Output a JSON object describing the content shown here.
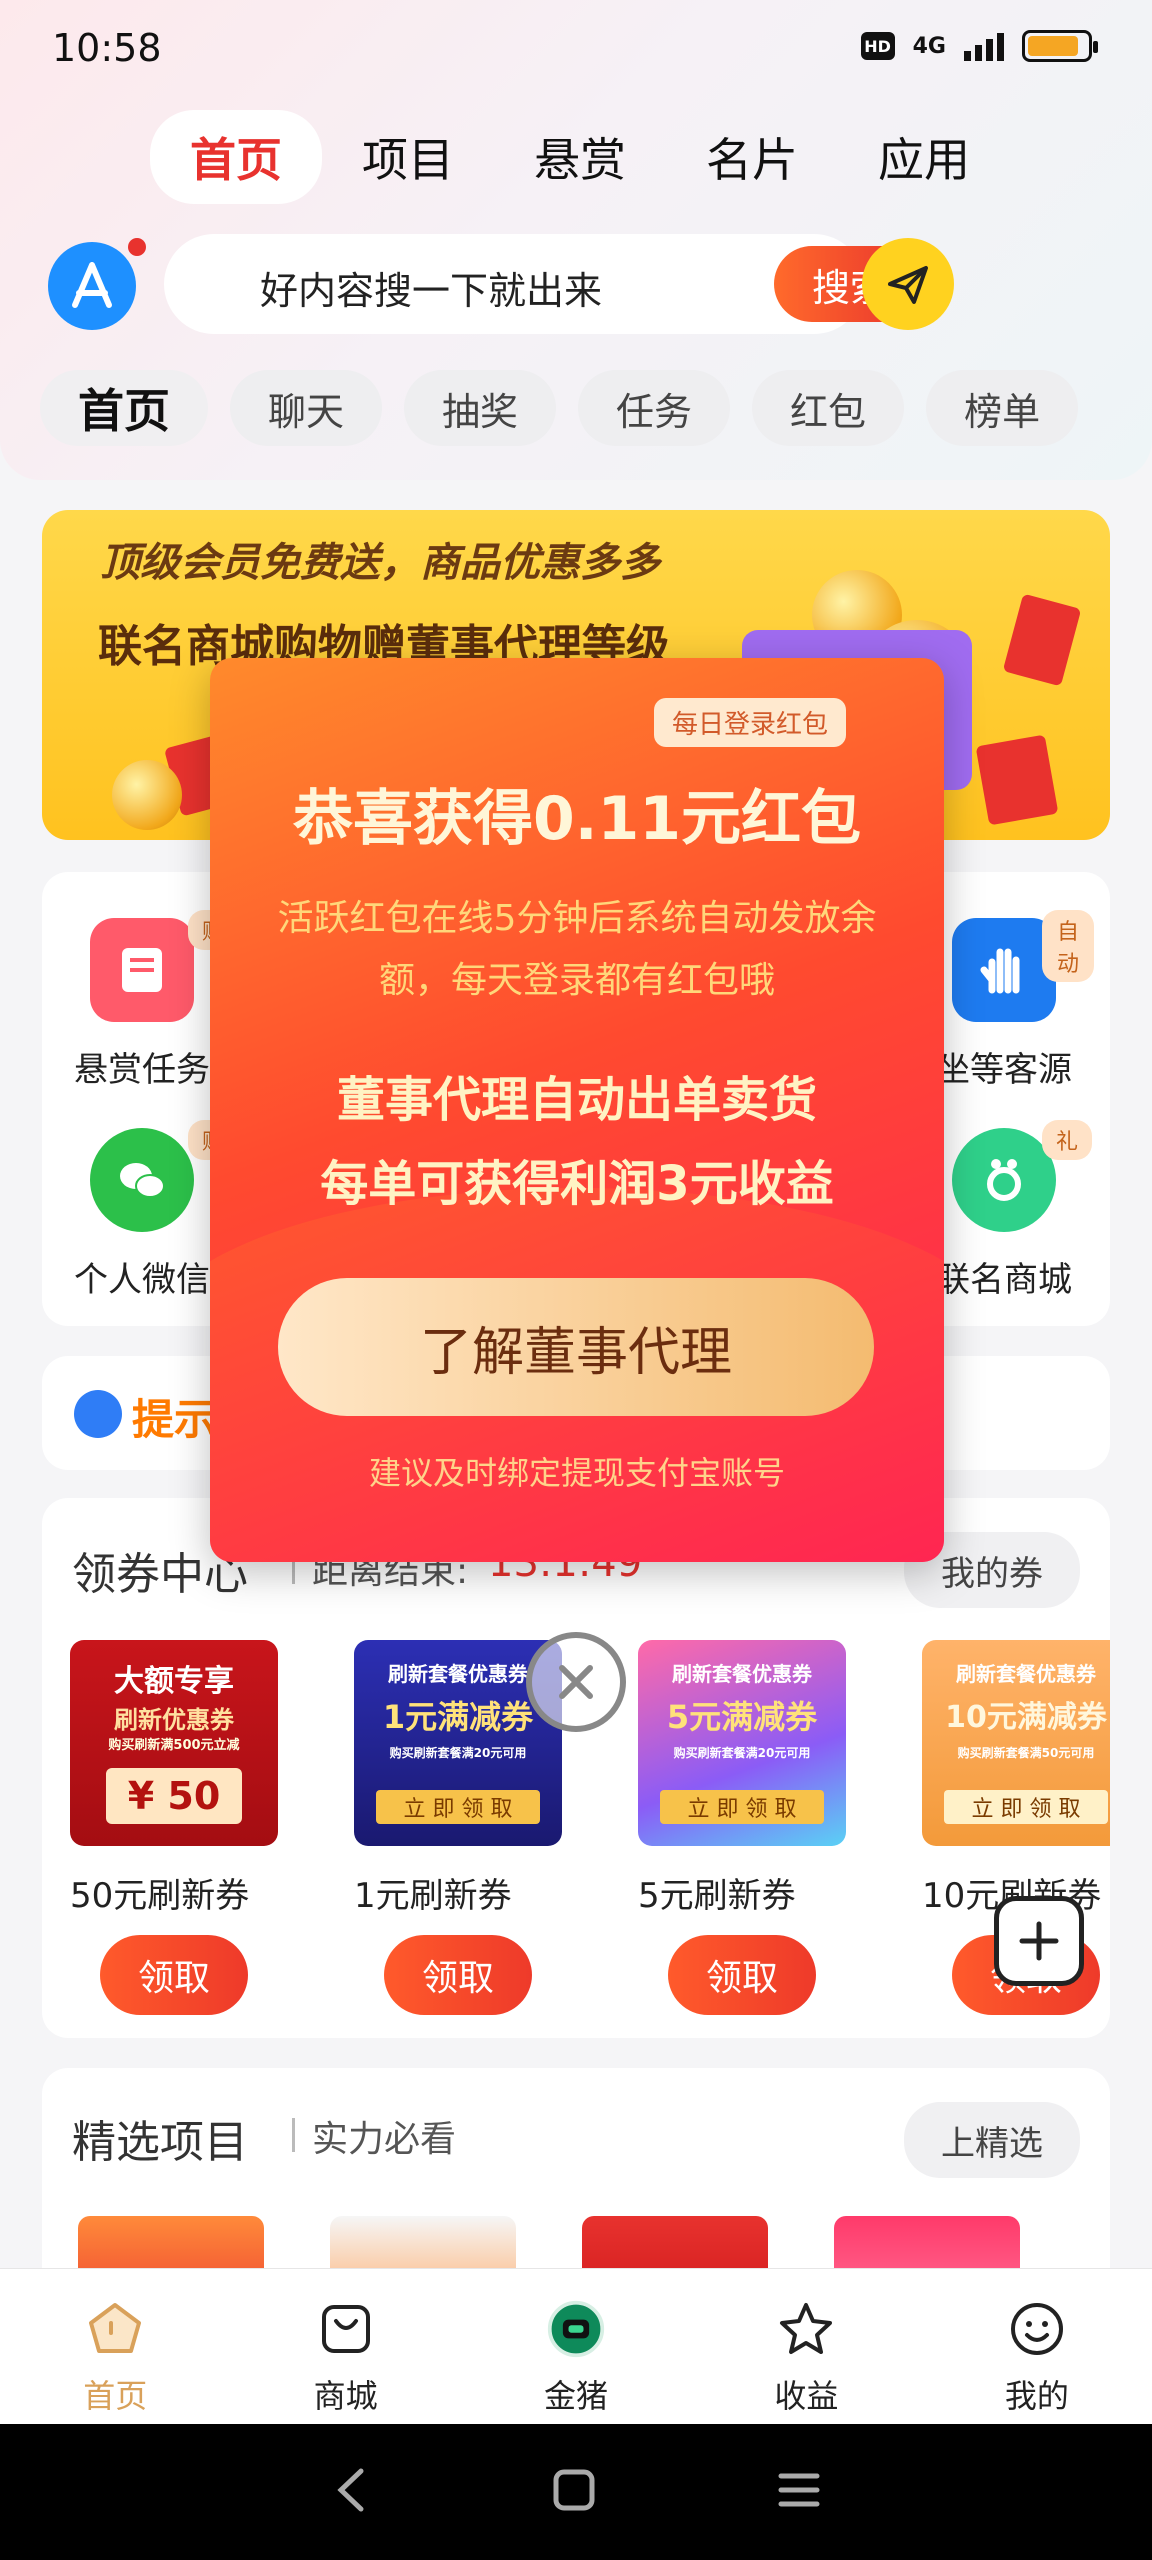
{
  "status": {
    "time": "10:58",
    "hd": "HD",
    "network": "4G"
  },
  "top_tabs": [
    "首页",
    "项目",
    "悬赏",
    "名片",
    "应用"
  ],
  "search": {
    "placeholder": "好内容搜一下就出来",
    "button": "搜索"
  },
  "sub_tabs": [
    "首页",
    "聊天",
    "抽奖",
    "任务",
    "红包",
    "榜单"
  ],
  "banner": {
    "line1": "顶级会员免费送，商品优惠多多",
    "line2": "联名商城购物赠董事代理等级"
  },
  "grid": {
    "items": [
      {
        "label": "悬赏任务",
        "tag": "赚"
      },
      {
        "label": "坐等客源",
        "tag": "自动"
      },
      {
        "label": "个人微信",
        "tag": "赚"
      },
      {
        "label": "联名商城",
        "tag": "礼"
      }
    ]
  },
  "notice": {
    "text": "提示"
  },
  "coupons": {
    "title": "领券中心",
    "countdown_label": "距离结束:",
    "countdown": "13:1:49",
    "my_coupons": "我的券",
    "items": [
      {
        "name": "50元刷新券",
        "claim": "领取",
        "img_title": "大额专享",
        "img_sub": "刷新优惠券",
        "img_note": "购买刷新满500元立减",
        "img_value": "¥ 50"
      },
      {
        "name": "1元刷新券",
        "claim": "领取",
        "img_title": "刷新套餐优惠券",
        "img_big": "1元满减券",
        "img_note": "购买刷新套餐满20元可用",
        "img_strip": "立 即 领 取"
      },
      {
        "name": "5元刷新券",
        "claim": "领取",
        "img_title": "刷新套餐优惠券",
        "img_big": "5元满减券",
        "img_note": "购买刷新套餐满20元可用",
        "img_strip": "立 即 领 取"
      },
      {
        "name": "10元刷新券",
        "claim": "领取",
        "img_title": "刷新套餐优惠券",
        "img_big": "10元满减券",
        "img_note": "购买刷新套餐满50元可用",
        "img_strip": "立 即 领 取"
      }
    ]
  },
  "featured": {
    "title": "精选项目",
    "subtitle": "实力必看",
    "action": "上精选"
  },
  "bottom_nav": [
    "首页",
    "商城",
    "金猪",
    "收益",
    "我的"
  ],
  "popup": {
    "tag": "每日登录红包",
    "title": "恭喜获得0.11元红包",
    "desc": "活跃红包在线5分钟后系统自动发放余额，每天登录都有红包哦",
    "strong1": "董事代理自动出单卖货",
    "strong2": "每单可获得利润3元收益",
    "button": "了解董事代理",
    "footer": "建议及时绑定提现支付宝账号"
  },
  "colors": {
    "accent": "#e8322e",
    "gold": "#d9a15a",
    "popup_orange": "#ff8a2c",
    "popup_pink": "#ff1f5a"
  }
}
